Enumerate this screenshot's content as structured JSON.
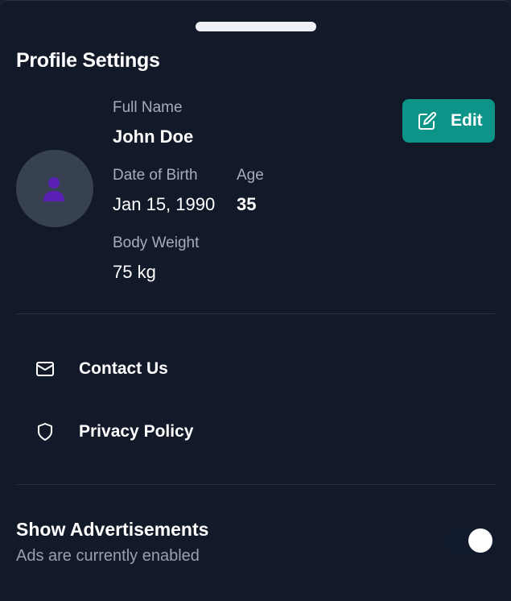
{
  "page": {
    "title": "Profile Settings"
  },
  "profile": {
    "avatar_icon": "user-silhouette-icon",
    "full_name_label": "Full Name",
    "full_name": "John Doe",
    "dob_label": "Date of Birth",
    "dob": "Jan 15, 1990",
    "age_label": "Age",
    "age": "35",
    "weight_label": "Body Weight",
    "weight": "75 kg"
  },
  "edit_button": {
    "label": "Edit",
    "icon": "edit-icon"
  },
  "menu": [
    {
      "label": "Contact Us",
      "icon": "mail-icon"
    },
    {
      "label": "Privacy Policy",
      "icon": "shield-icon"
    }
  ],
  "ads": {
    "title": "Show Advertisements",
    "status": "Ads are currently enabled",
    "enabled": true
  },
  "colors": {
    "background": "#121929",
    "accent": "#0d9488",
    "avatar_bg": "#374151",
    "avatar_figure": "#5b21b6",
    "muted_text": "#a7adb8"
  }
}
